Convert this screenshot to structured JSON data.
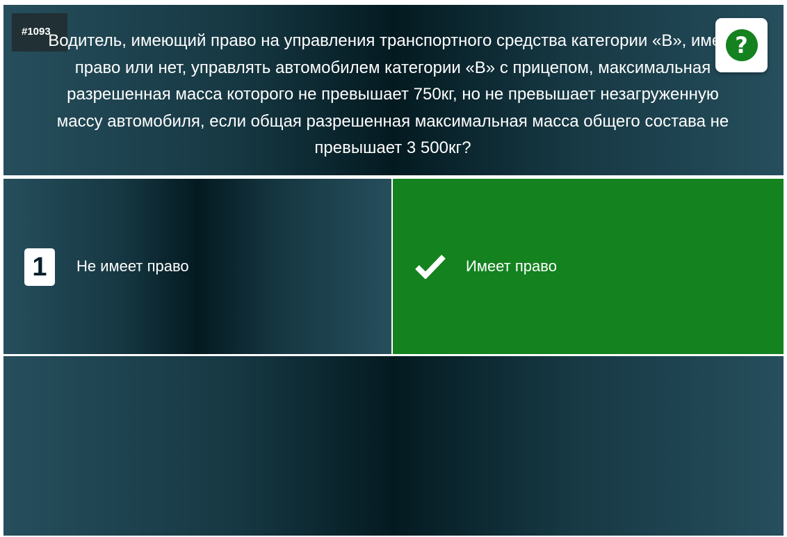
{
  "question": {
    "id": "#1093",
    "text": "Водитель, имеющий право на управления транспортного средства категории «В», имеет право или нет, управлять автомобилем категории «В» с прицепом, максимальная разрешенная масса которого не превышает 750кг, но не превышает незагруженную массу автомобиля, если общая разрешенная максимальная масса общего состава не превышает 3 500кг?"
  },
  "help_button": {
    "icon": "question-mark-icon",
    "glyph": "?"
  },
  "answers": [
    {
      "number": "1",
      "text": "Не имеет право",
      "selected": false
    },
    {
      "icon": "checkmark-icon",
      "text": "Имеет право",
      "selected": true,
      "color": "#13821f"
    }
  ],
  "colors": {
    "panel_dark": "#041a21",
    "panel_light": "#264e5c",
    "correct_green": "#13821f",
    "help_icon_green": "#14821f"
  }
}
